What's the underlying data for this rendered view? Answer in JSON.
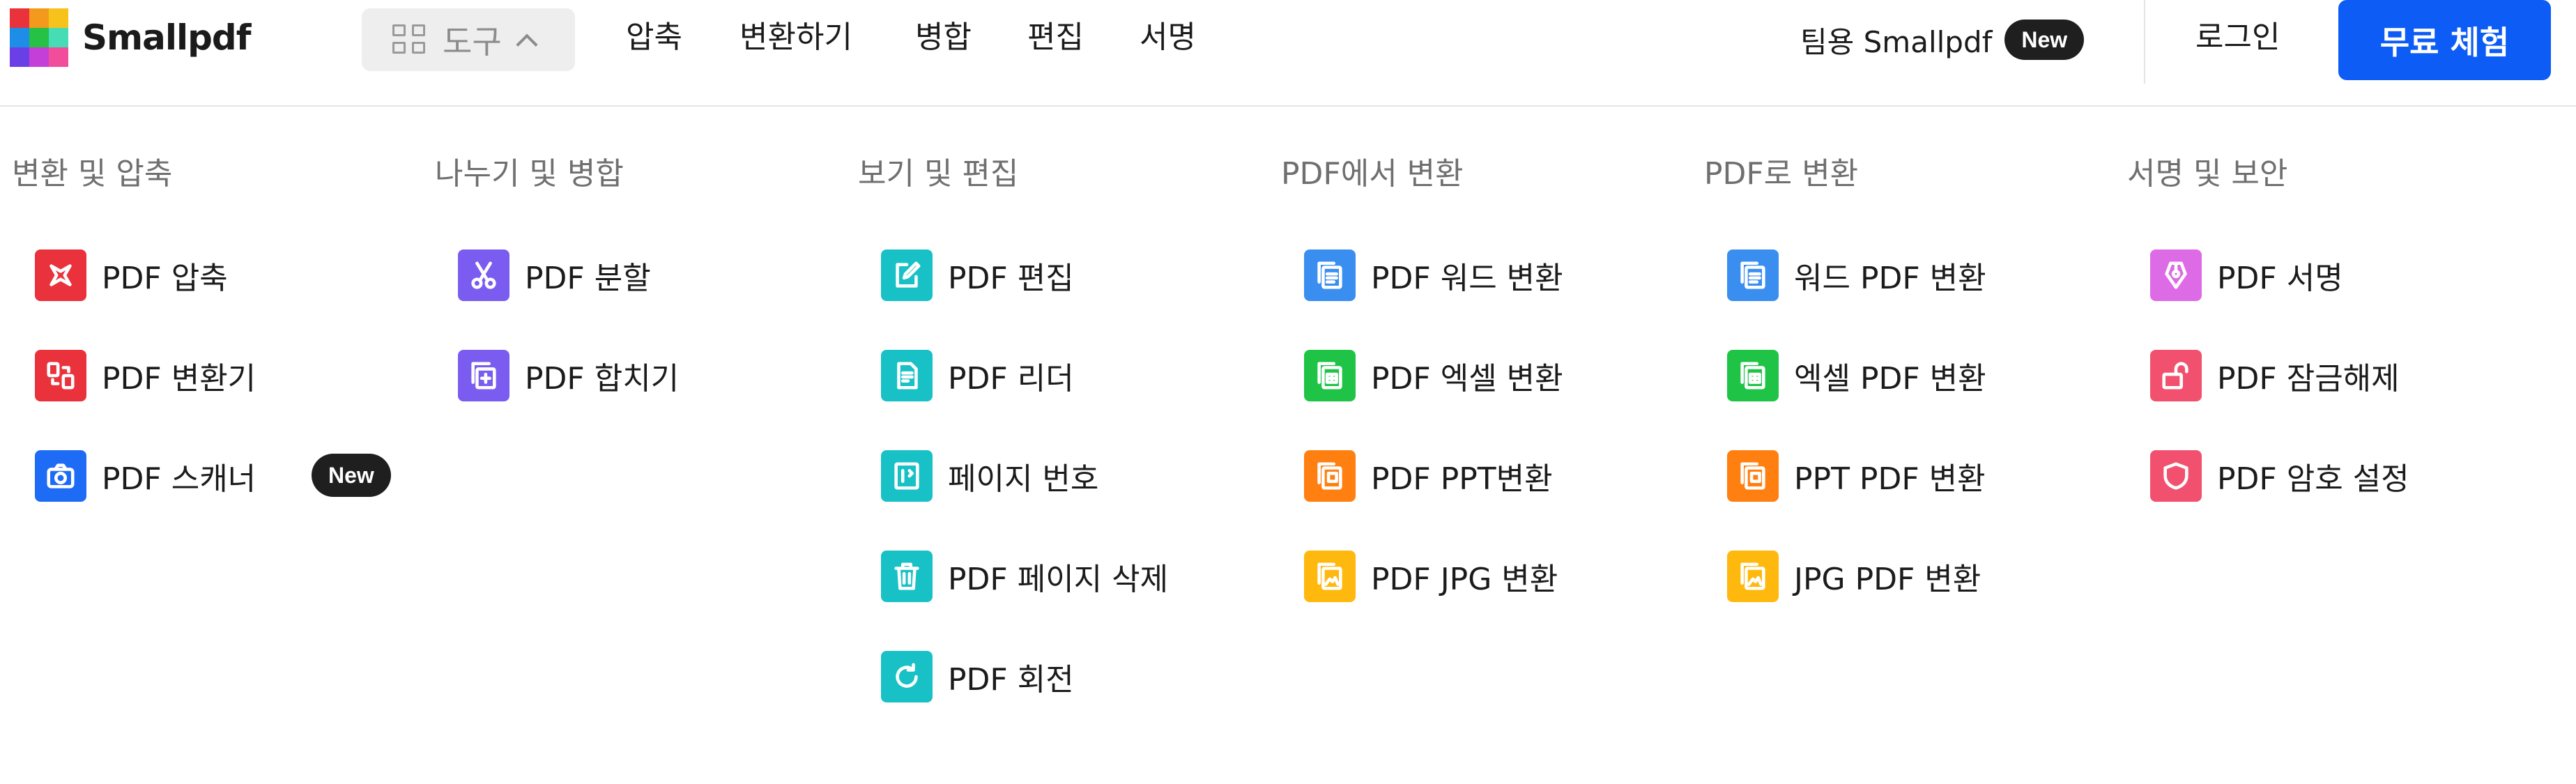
{
  "brand": {
    "name": "Smallpdf",
    "logo_colors": [
      "#e9323b",
      "#f39a1c",
      "#f7c21b",
      "#1e8de8",
      "#25c246",
      "#46ddb6",
      "#6b3fe6",
      "#c43fd8",
      "#f24d9a"
    ]
  },
  "header": {
    "tools_label": "도구",
    "nav": [
      "압축",
      "변환하기",
      "병합",
      "편집",
      "서명"
    ],
    "team_label": "팀용 Smallpdf",
    "team_badge": "New",
    "login": "로그인",
    "cta": "무료 체험",
    "cta_color": "#0c5cf5"
  },
  "menu": {
    "columns": [
      {
        "title": "변환 및 압축",
        "items": [
          {
            "label": "PDF 압축",
            "icon": "compress-icon",
            "color": "#e9323b"
          },
          {
            "label": "PDF 변환기",
            "icon": "convert-icon",
            "color": "#e9323b"
          },
          {
            "label": "PDF 스캐너",
            "icon": "camera-icon",
            "color": "#1e6bf5",
            "badge": "New"
          }
        ]
      },
      {
        "title": "나누기 및 병합",
        "items": [
          {
            "label": "PDF 분할",
            "icon": "scissors-icon",
            "color": "#7b5cf0"
          },
          {
            "label": "PDF 합치기",
            "icon": "merge-icon",
            "color": "#7b5cf0"
          }
        ]
      },
      {
        "title": "보기 및 편집",
        "items": [
          {
            "label": "PDF 편집",
            "icon": "edit-icon",
            "color": "#18c1c6"
          },
          {
            "label": "PDF 리더",
            "icon": "reader-icon",
            "color": "#18c1c6"
          },
          {
            "label": "페이지 번호",
            "icon": "page-number-icon",
            "color": "#18c1c6"
          },
          {
            "label": "PDF 페이지 삭제",
            "icon": "trash-icon",
            "color": "#18c1c6"
          },
          {
            "label": "PDF 회전",
            "icon": "rotate-icon",
            "color": "#18c1c6"
          }
        ]
      },
      {
        "title": "PDF에서 변환",
        "items": [
          {
            "label": "PDF 워드 변환",
            "icon": "word-icon",
            "color": "#3a8ef0"
          },
          {
            "label": "PDF 엑셀 변환",
            "icon": "excel-icon",
            "color": "#1fc447"
          },
          {
            "label": "PDF PPT변환",
            "icon": "ppt-icon",
            "color": "#ff7f11"
          },
          {
            "label": "PDF JPG 변환",
            "icon": "jpg-icon",
            "color": "#ffb80d"
          }
        ]
      },
      {
        "title": "PDF로 변환",
        "items": [
          {
            "label": "워드 PDF 변환",
            "icon": "word-icon",
            "color": "#3a8ef0"
          },
          {
            "label": "엑셀 PDF 변환",
            "icon": "excel-icon",
            "color": "#1fc447"
          },
          {
            "label": "PPT PDF 변환",
            "icon": "ppt-icon",
            "color": "#ff7f11"
          },
          {
            "label": "JPG PDF 변환",
            "icon": "jpg-icon",
            "color": "#ffb80d"
          }
        ]
      },
      {
        "title": "서명 및 보안",
        "items": [
          {
            "label": "PDF 서명",
            "icon": "pen-icon",
            "color": "#de6be6"
          },
          {
            "label": "PDF 잠금해제",
            "icon": "unlock-icon",
            "color": "#f2506f"
          },
          {
            "label": "PDF 암호 설정",
            "icon": "shield-icon",
            "color": "#f2506f"
          }
        ]
      }
    ]
  }
}
